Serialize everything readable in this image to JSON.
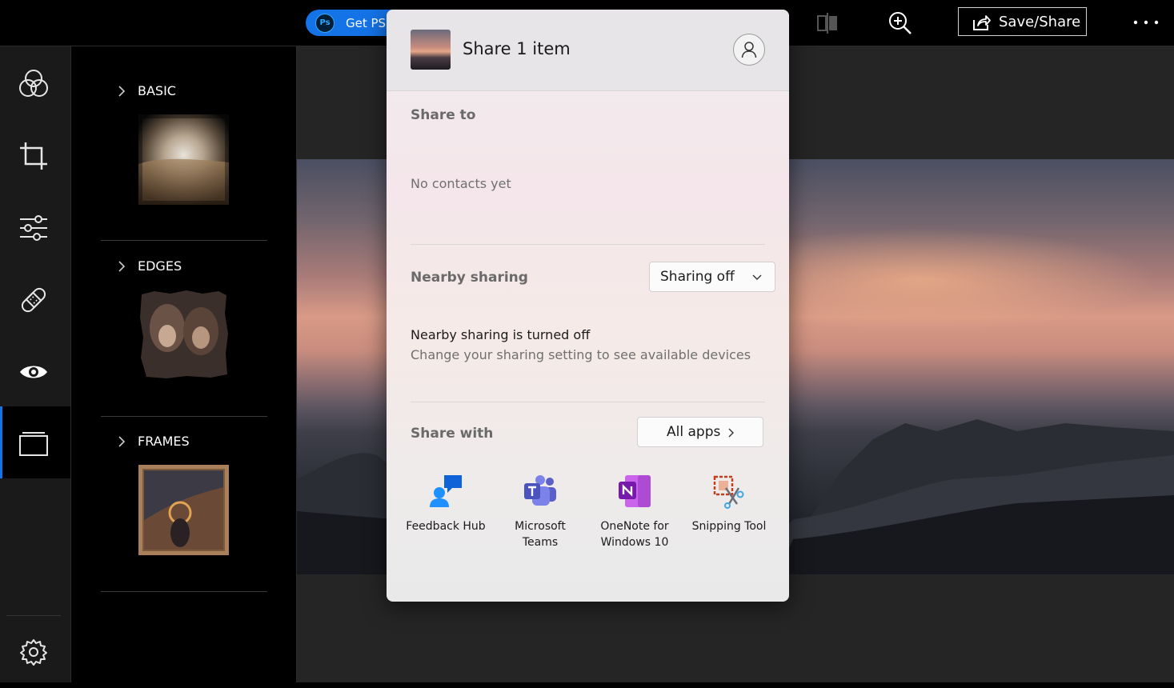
{
  "topbar": {
    "get_ps_label": "Get PS",
    "ps_logo_text": "Ps",
    "save_share_label": "Save/Share",
    "icons": [
      "photoshop-logo-icon",
      "compare-icon",
      "zoom-in-icon",
      "share-icon",
      "more-icon"
    ]
  },
  "rail": {
    "items": [
      {
        "icon": "looks-circles-icon"
      },
      {
        "icon": "crop-icon"
      },
      {
        "icon": "adjustments-sliders-icon"
      },
      {
        "icon": "bandage-heal-icon"
      },
      {
        "icon": "eye-icon"
      },
      {
        "icon": "borders-frame-icon",
        "active": true
      }
    ],
    "settings_icon": "gear-icon",
    "accent": "#1473e6"
  },
  "panel": {
    "sections": [
      {
        "title": "BASIC"
      },
      {
        "title": "EDGES"
      },
      {
        "title": "FRAMES"
      }
    ]
  },
  "share": {
    "title": "Share 1 item",
    "share_to_label": "Share to",
    "no_contacts": "No contacts yet",
    "nearby_label": "Nearby sharing",
    "nearby_value": "Sharing off",
    "nearby_status": "Nearby sharing is turned off",
    "nearby_hint": "Change your sharing setting to see available devices",
    "share_with_label": "Share with",
    "all_apps_label": "All apps",
    "apps": [
      {
        "line1": "Feedback Hub",
        "line2": "",
        "icon": "feedback-hub-icon"
      },
      {
        "line1": "Microsoft",
        "line2": "Teams",
        "icon": "teams-icon"
      },
      {
        "line1": "OneNote for",
        "line2": "Windows 10",
        "icon": "onenote-icon"
      },
      {
        "line1": "Snipping Tool",
        "line2": "",
        "icon": "snipping-tool-icon"
      }
    ]
  }
}
